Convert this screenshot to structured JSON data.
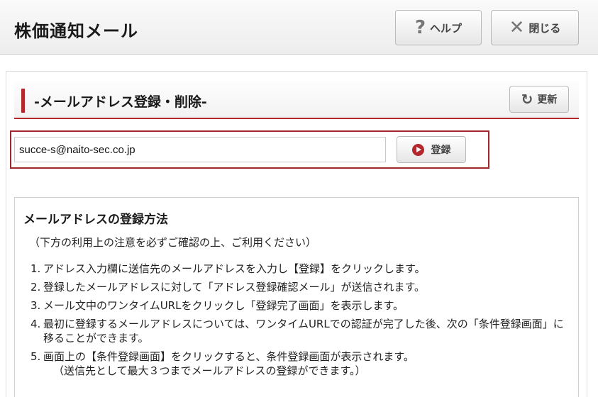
{
  "header": {
    "title": "株価通知メール",
    "help_label": "ヘルプ",
    "close_label": "閉じる"
  },
  "section": {
    "title": "-メールアドレス登録・削除-",
    "refresh_label": "更新"
  },
  "form": {
    "email_value": "succe-s@naito-sec.co.jp",
    "register_label": "登録"
  },
  "info": {
    "title": "メールアドレスの登録方法",
    "note": "（下方の利用上の注意を必ずご確認の上、ご利用ください）",
    "steps": [
      {
        "num": "1.",
        "text": "アドレス入力欄に送信先のメールアドレスを入力し【登録】をクリックします。"
      },
      {
        "num": "2.",
        "text": "登録したメールアドレスに対して「アドレス登録確認メール」が送信されます。"
      },
      {
        "num": "3.",
        "text": "メール文中のワンタイムURLをクリックし「登録完了画面」を表示します。"
      },
      {
        "num": "4.",
        "text": "最初に登録するメールアドレスについては、ワンタイムURLでの認証が完了した後、次の「条件登録画面」に移ることができます。"
      },
      {
        "num": "5.",
        "text": "画面上の【条件登録画面】をクリックすると、条件登録画面が表示されます。",
        "sub": "（送信先として最大３つまでメールアドレスの登録ができます。）"
      }
    ]
  },
  "colors": {
    "accent": "#b3272d"
  },
  "icons": {
    "help": "question-icon",
    "close": "x-icon",
    "refresh": "refresh-icon",
    "register": "play-circle-icon"
  }
}
